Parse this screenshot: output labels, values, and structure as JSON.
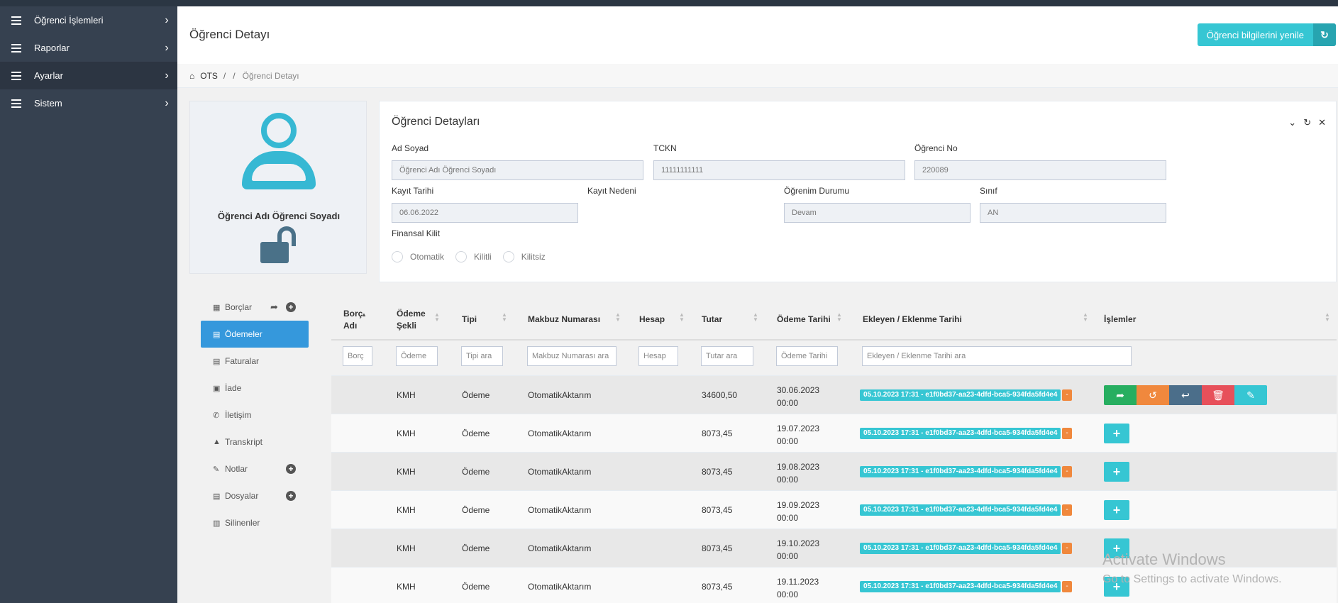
{
  "sidebar": {
    "items": [
      {
        "label": "Öğrenci İşlemleri"
      },
      {
        "label": "Raporlar"
      },
      {
        "label": "Ayarlar"
      },
      {
        "label": "Sistem"
      }
    ]
  },
  "header": {
    "title": "Öğrenci Detayı",
    "refresh_label": "Öğrenci bilgilerini yenile"
  },
  "breadcrumb": {
    "home": "OTS",
    "sep1": "/",
    "sep2": "/",
    "current": "Öğrenci Detayı"
  },
  "profile": {
    "name": "Öğrenci Adı Öğrenci Soyadı"
  },
  "tabs": {
    "borclar": "Borçlar",
    "odemeler": "Ödemeler",
    "faturalar": "Faturalar",
    "iade": "İade",
    "iletisim": "İletişim",
    "transkript": "Transkript",
    "notlar": "Notlar",
    "dosyalar": "Dosyalar",
    "silinenler": "Silinenler"
  },
  "details": {
    "title": "Öğrenci Detayları",
    "ad_soyad_label": "Ad Soyad",
    "ad_soyad_value": "Öğrenci Adı Öğrenci Soyadı",
    "tckn_label": "TCKN",
    "tckn_value": "11111111111",
    "ogrenci_no_label": "Öğrenci No",
    "ogrenci_no_value": "220089",
    "kayit_tarihi_label": "Kayıt Tarihi",
    "kayit_tarihi_value": "06.06.2022",
    "kayit_nedeni_label": "Kayıt Nedeni",
    "ogrenim_durumu_label": "Öğrenim Durumu",
    "ogrenim_durumu_value": "Devam",
    "sinif_label": "Sınıf",
    "sinif_value": "AN",
    "finansal_kilit_label": "Finansal Kilit",
    "radio_otomatik": "Otomatik",
    "radio_kilitli": "Kilitli",
    "radio_kilitsiz": "Kilitsiz"
  },
  "table": {
    "headers": {
      "borc_adi_1": "Borç",
      "borc_adi_2": "Adı",
      "odeme_sekli_1": "Ödeme",
      "odeme_sekli_2": "Şekli",
      "tipi": "Tipi",
      "makbuz": "Makbuz Numarası",
      "hesap": "Hesap",
      "tutar": "Tutar",
      "odeme_tarihi": "Ödeme Tarihi",
      "ekleyen": "Ekleyen / Eklenme Tarihi",
      "islemler": "İşlemler"
    },
    "filters": {
      "borc": "Borç",
      "odeme": "Ödeme",
      "tipi": "Tipi ara",
      "makbuz": "Makbuz Numarası ara",
      "hesap": "Hesap",
      "tutar": "Tutar ara",
      "odeme_tarihi": "Ödeme Tarihi",
      "ekleyen": "Ekleyen / Eklenme Tarihi ara"
    },
    "rows": [
      {
        "odeme_sekli": "KMH",
        "tipi": "Ödeme",
        "makbuz": "OtomatikAktarım",
        "tutar": "34600,50",
        "tarih1": "30.06.2023",
        "tarih2": "00:00",
        "ekleyen": "05.10.2023 17:31 - e1f0bd37-aa23-4dfd-bca5-934fda5fd4e4",
        "minus": "-"
      },
      {
        "odeme_sekli": "KMH",
        "tipi": "Ödeme",
        "makbuz": "OtomatikAktarım",
        "tutar": "8073,45",
        "tarih1": "19.07.2023",
        "tarih2": "00:00",
        "ekleyen": "05.10.2023 17:31 - e1f0bd37-aa23-4dfd-bca5-934fda5fd4e4",
        "minus": "-"
      },
      {
        "odeme_sekli": "KMH",
        "tipi": "Ödeme",
        "makbuz": "OtomatikAktarım",
        "tutar": "8073,45",
        "tarih1": "19.08.2023",
        "tarih2": "00:00",
        "ekleyen": "05.10.2023 17:31 - e1f0bd37-aa23-4dfd-bca5-934fda5fd4e4",
        "minus": "-"
      },
      {
        "odeme_sekli": "KMH",
        "tipi": "Ödeme",
        "makbuz": "OtomatikAktarım",
        "tutar": "8073,45",
        "tarih1": "19.09.2023",
        "tarih2": "00:00",
        "ekleyen": "05.10.2023 17:31 - e1f0bd37-aa23-4dfd-bca5-934fda5fd4e4",
        "minus": "-"
      },
      {
        "odeme_sekli": "KMH",
        "tipi": "Ödeme",
        "makbuz": "OtomatikAktarım",
        "tutar": "8073,45",
        "tarih1": "19.10.2023",
        "tarih2": "00:00",
        "ekleyen": "05.10.2023 17:31 - e1f0bd37-aa23-4dfd-bca5-934fda5fd4e4",
        "minus": "-"
      },
      {
        "odeme_sekli": "KMH",
        "tipi": "Ödeme",
        "makbuz": "OtomatikAktarım",
        "tutar": "8073,45",
        "tarih1": "19.11.2023",
        "tarih2": "00:00",
        "ekleyen": "05.10.2023 17:31 - e1f0bd37-aa23-4dfd-bca5-934fda5fd4e4",
        "minus": "-"
      }
    ]
  },
  "watermark": {
    "line1": "Activate Windows",
    "line2": "Go to Settings to activate Windows."
  },
  "colors": {
    "sidebar": "#364150",
    "accent": "#36c6d3",
    "primary": "#3598dc",
    "success": "#27ae60",
    "warning": "#f0883d",
    "danger": "#e7505a"
  }
}
